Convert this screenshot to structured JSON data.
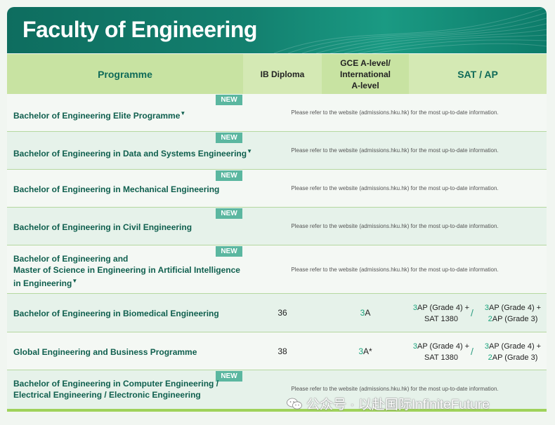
{
  "header": {
    "title": "Faculty of Engineering"
  },
  "columns": {
    "programme": "Programme",
    "ib": "IB Diploma",
    "gce_line1": "GCE A-level/",
    "gce_line2": "International",
    "gce_line3": "A-level",
    "sat": "SAT / AP"
  },
  "badge_label": "NEW",
  "rows": [
    {
      "name": "Bachelor of Engineering Elite Programme",
      "marker": "▼",
      "new": true,
      "note": "Please refer to the website (admissions.hku.hk) for the most up-to-date information."
    },
    {
      "name": "Bachelor of Engineering in Data and Systems Engineering",
      "marker": "▼",
      "new": true,
      "note": "Please refer to the website (admissions.hku.hk) for the most up-to-date information."
    },
    {
      "name": "Bachelor of Engineering in Mechanical Engineering",
      "new": true,
      "note": "Please refer to the website (admissions.hku.hk) for the most up-to-date information."
    },
    {
      "name": "Bachelor of Engineering in Civil Engineering",
      "new": true,
      "note": "Please refer to the website (admissions.hku.hk) for the most up-to-date information."
    },
    {
      "name_line1": "Bachelor of Engineering and",
      "name_line2": "Master of Science in Engineering in Artificial Intelligence",
      "name_line3": "in Engineering",
      "marker": "▼",
      "new": true,
      "note": "Please refer to the website (admissions.hku.hk) for the most up-to-date information."
    },
    {
      "name": "Bachelor of Engineering in Biomedical Engineering",
      "ib": "36",
      "gce_num": "3",
      "gce_grade": "A",
      "sat1_num": "3",
      "sat1_line1": "AP (Grade 4) +",
      "sat1_line2": "SAT 1380",
      "slash": "/",
      "sat2_num1": "3",
      "sat2_line1": "AP (Grade 4) +",
      "sat2_num2": "2",
      "sat2_line2": "AP (Grade 3)"
    },
    {
      "name": "Global Engineering and Business Programme",
      "ib": "38",
      "gce_num": "3",
      "gce_grade": "A*",
      "sat1_num": "3",
      "sat1_line1": "AP (Grade 4) +",
      "sat1_line2": "SAT 1380",
      "slash": "/",
      "sat2_num1": "3",
      "sat2_line1": "AP (Grade 4) +",
      "sat2_num2": "2",
      "sat2_line2": "AP (Grade 3)"
    },
    {
      "name_line1": "Bachelor of Engineering in Computer Engineering /",
      "name_line2": "Electrical Engineering / Electronic Engineering",
      "new": true,
      "note": "Please refer to the website (admissions.hku.hk) for the most up-to-date information."
    }
  ],
  "watermark": {
    "text": "公众号 · 以赴国际InfiniteFuture",
    "icon": "wechat-icon"
  }
}
